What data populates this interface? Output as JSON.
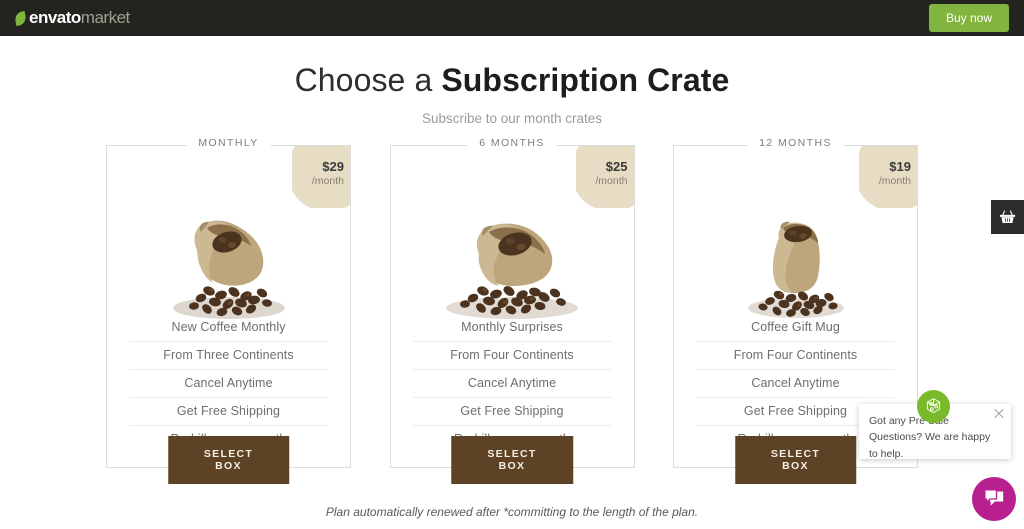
{
  "envato_bar": {
    "logo_first": "envato",
    "logo_second": "market",
    "buy_now_label": "Buy now"
  },
  "heading": {
    "title_light": "Choose a ",
    "title_bold": "Subscription Crate",
    "subtitle": "Subscribe to our month crates"
  },
  "plans": [
    {
      "title": "MONTHLY",
      "price": "$29",
      "period": "/month",
      "features": [
        "New Coffee Monthly",
        "From Three Continents",
        "Cancel Anytime",
        "Get Free Shipping",
        "Re-bills every month"
      ],
      "button_label": "SELECT BOX"
    },
    {
      "title": "6 MONTHS",
      "price": "$25",
      "period": "/month",
      "features": [
        "Monthly Surprises",
        "From Four Continents",
        "Cancel Anytime",
        "Get Free Shipping",
        "Re-bills every month"
      ],
      "button_label": "SELECT BOX"
    },
    {
      "title": "12 MONTHS",
      "price": "$19",
      "period": "/month",
      "features": [
        "Coffee Gift Mug",
        "From Four Continents",
        "Cancel Anytime",
        "Get Free Shipping",
        "Re-bills every month"
      ],
      "button_label": "SELECT BOX"
    }
  ],
  "footer_note": "Plan automatically renewed after *committing to the length of the plan.",
  "chat": {
    "message": "Got any Pre Sale Questions? We are happy to help."
  },
  "colors": {
    "topbar_bg": "#23241f",
    "buy_now_green": "#82b440",
    "blob_beige": "#e7dcc4",
    "button_brown": "#5d4225",
    "chat_magenta": "#b81f8f",
    "avatar_green": "#7ab929"
  }
}
